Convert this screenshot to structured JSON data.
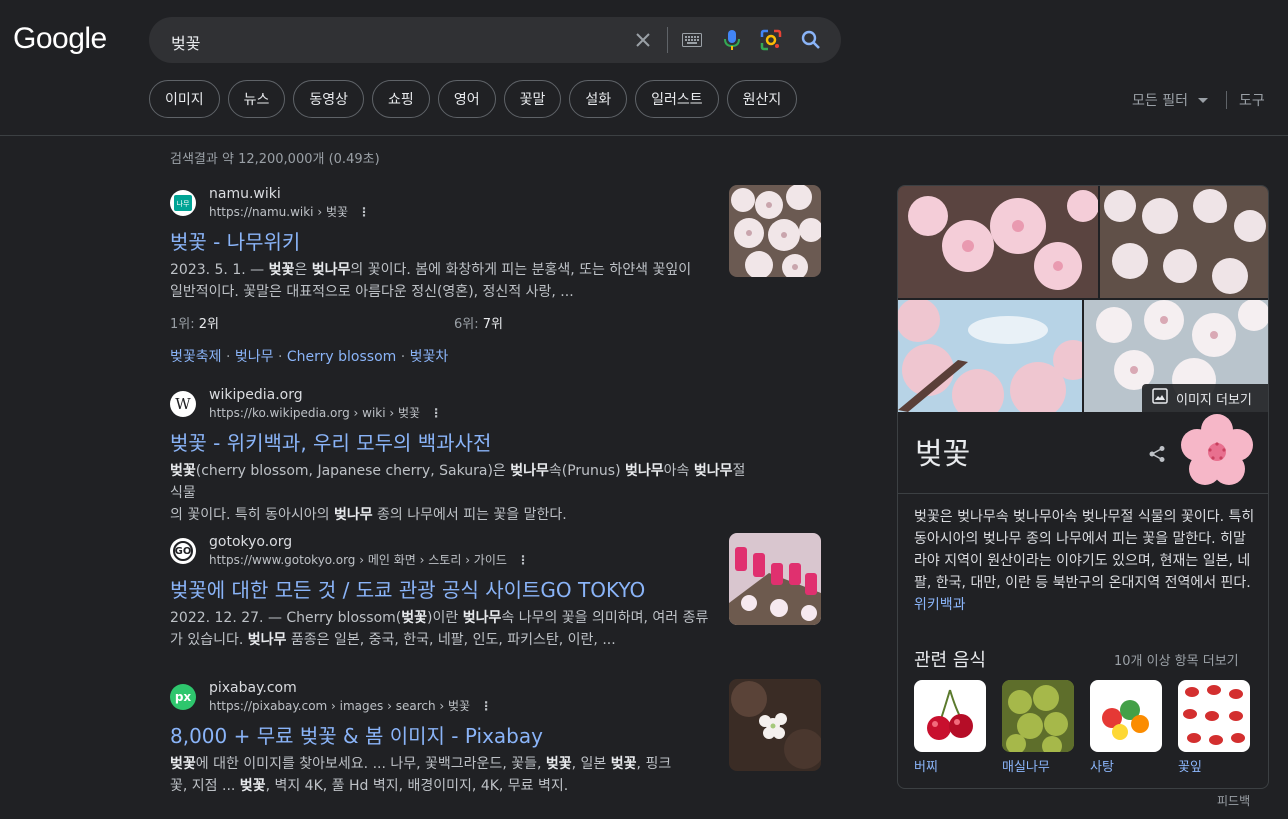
{
  "header": {
    "logo": "Google",
    "query": "벚꽃",
    "chips": [
      "이미지",
      "뉴스",
      "동영상",
      "쇼핑",
      "영어",
      "꽃말",
      "설화",
      "일러스트",
      "원산지"
    ],
    "all_filters": "모든 필터",
    "tools": "도구"
  },
  "stats": "검색결과 약 12,200,000개 (0.49초)",
  "results": [
    {
      "site": "namu.wiki",
      "url": "https://namu.wiki › 벚꽃",
      "title": "벚꽃 - 나무위키",
      "snippet_line1_date": "2023. 5. 1. — ",
      "snippet_b1": "벚꽃",
      "snippet_t1": "은 ",
      "snippet_b2": "벚나무",
      "snippet_t2": "의 꽃이다. 봄에 화창하게 피는 분홍색, 또는 하얀색 꽃잎이",
      "snippet_line2": "일반적이다. 꽃말은 대표적으로 아름다운 정신(영혼), 정신적 사랑, ...",
      "rank1_label": "1위: ",
      "rank1_value": "2위",
      "rank2_label": "6위: ",
      "rank2_value": "7위",
      "sublinks": [
        "벚꽃축제",
        "벚나무",
        "Cherry blossom",
        "벚꽃차"
      ]
    },
    {
      "site": "wikipedia.org",
      "url": "https://ko.wikipedia.org › wiki › 벚꽃",
      "title": "벚꽃 - 위키백과, 우리 모두의 백과사전",
      "s_b1": "벚꽃",
      "s_t1": "(cherry blossom, Japanese cherry, Sakura)은 ",
      "s_b2": "벚나무",
      "s_t2": "속(Prunus) ",
      "s_b3": "벚나무",
      "s_t3": "아속 ",
      "s_b4": "벚나무",
      "s_t4": "절 식물",
      "s_t5": "의 꽃이다. 특히 동아시아의 ",
      "s_b5": "벚나무",
      "s_t6": " 종의 나무에서 피는 꽃을 말한다."
    },
    {
      "site": "gotokyo.org",
      "url": "https://www.gotokyo.org › 메인 화면 › 스토리 › 가이드",
      "title": "벚꽃에 대한 모든 것 / 도쿄 관광 공식 사이트GO TOKYO",
      "s_t1": "2022. 12. 27. — Cherry blossom(",
      "s_b1": "벚꽃",
      "s_t2": ")이란 ",
      "s_b2": "벚나무",
      "s_t3": "속 나무의 꽃을 의미하며, 여러 종류",
      "s_t4": "가 있습니다. ",
      "s_b3": "벚나무",
      "s_t5": " 품종은 일본, 중국, 한국, 네팔, 인도, 파키스탄, 이란, ..."
    },
    {
      "site": "pixabay.com",
      "url": "https://pixabay.com › images › search › 벚꽃",
      "title": "8,000 + 무료 벚꽃 & 봄 이미지 - Pixabay",
      "s_b1": "벚꽃",
      "s_t1": "에 대한 이미지를 찾아보세요. ... 나무, 꽃백그라운드, 꽃들, ",
      "s_b2": "벚꽃",
      "s_t2": ", 일본 ",
      "s_b3": "벚꽃",
      "s_t3": ", 핑크",
      "s_t4": "꽃, 지점 ... ",
      "s_b4": "벚꽃",
      "s_t5": ", 벽지 4K, 풀 Hd 벽지, 배경이미지, 4K, 무료 벽지."
    }
  ],
  "knowledge_panel": {
    "more_images": "이미지 더보기",
    "title": "벚꽃",
    "description": "벚꽃은 벚나무속 벚나무아속 벚나무절 식물의 꽃이다. 특히 동아시아의 벚나무 종의 나무에서 피는 꽃을 말한다. 히말라야 지역이 원산이라는 이야기도 있으며, 현재는 일본, 네팔, 한국, 대만, 이란 등 북반구의 온대지역 전역에서 핀다. ",
    "description_link": "위키백과",
    "related_title": "관련 음식",
    "related_more": "10개 이상 항목 더보기",
    "foods": [
      "버찌",
      "매실나무",
      "사탕",
      "꽃잎"
    ]
  },
  "feedback": "피드백"
}
